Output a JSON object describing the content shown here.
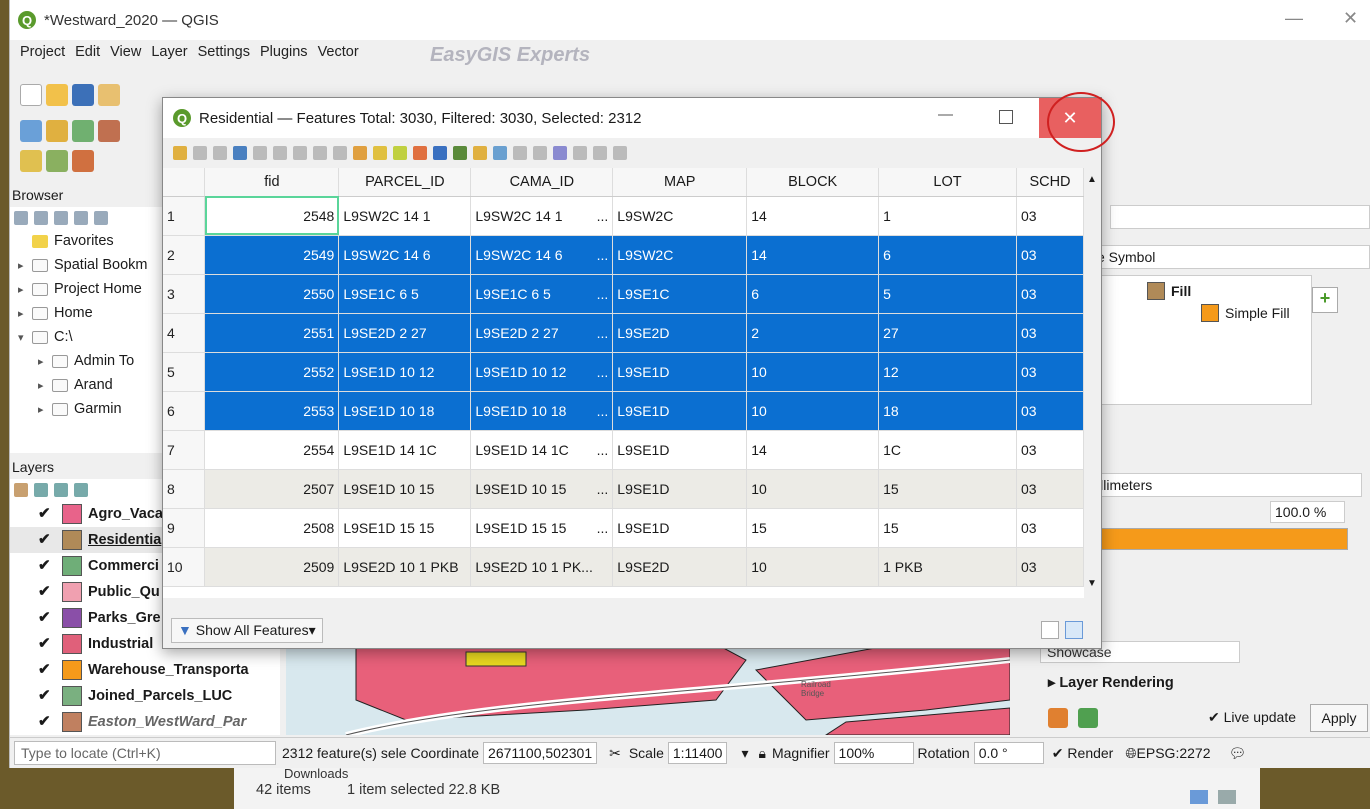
{
  "window": {
    "title": "*Westward_2020 — QGIS",
    "min": "—",
    "max": "☐",
    "close": "✕"
  },
  "menu": [
    "Project",
    "Edit",
    "View",
    "Layer",
    "Settings",
    "Plugins",
    "Vector"
  ],
  "watermark": "EasyGIS Experts",
  "browser": {
    "title": "Browser",
    "items": [
      {
        "label": "Favorites",
        "indent": 0
      },
      {
        "label": "Spatial Bookm",
        "indent": 0
      },
      {
        "label": "Project Home",
        "indent": 0
      },
      {
        "label": "Home",
        "indent": 0
      },
      {
        "label": "C:\\",
        "indent": 0
      },
      {
        "label": "Admin To",
        "indent": 1
      },
      {
        "label": "Arand",
        "indent": 1
      },
      {
        "label": "Garmin",
        "indent": 1
      }
    ]
  },
  "layers": {
    "title": "Layers",
    "items": [
      {
        "label": "Agro_Vaca",
        "color": "#e8638a"
      },
      {
        "label": "Residentia",
        "color": "#b08a58"
      },
      {
        "label": "Commerci",
        "color": "#6fae78"
      },
      {
        "label": "Public_Qu",
        "color": "#f0a0b0"
      },
      {
        "label": "Parks_Gre",
        "color": "#8a4fa8"
      },
      {
        "label": "Industrial",
        "color": "#e0607a"
      },
      {
        "label": "Warehouse_Transporta",
        "color": "#f59a1a"
      },
      {
        "label": "Joined_Parcels_LUC",
        "color": "#7ab080"
      },
      {
        "label": "Easton_WestWard_Par",
        "color": "#c08060"
      }
    ]
  },
  "attr": {
    "title": "Residential — Features Total: 3030, Filtered: 3030, Selected: 2312",
    "min": "—",
    "max": "☐",
    "close": "✕",
    "columns": [
      "fid",
      "PARCEL_ID",
      "CAMA_ID",
      "MAP",
      "BLOCK",
      "LOT",
      "SCHD"
    ],
    "rows": [
      {
        "n": "1",
        "fid": "2548",
        "parcel": "L9SW2C 14 1",
        "cama": "L9SW2C 14 1",
        "dots": "...",
        "map": "L9SW2C",
        "block": "14",
        "lot": "1",
        "schd": "03",
        "state": "focus"
      },
      {
        "n": "2",
        "fid": "2549",
        "parcel": "L9SW2C 14 6",
        "cama": "L9SW2C 14 6",
        "dots": "...",
        "map": "L9SW2C",
        "block": "14",
        "lot": "6",
        "schd": "03",
        "state": "sel"
      },
      {
        "n": "3",
        "fid": "2550",
        "parcel": "L9SE1C 6  5",
        "cama": "L9SE1C 6  5",
        "dots": "...",
        "map": "L9SE1C",
        "block": "6",
        "lot": "5",
        "schd": "03",
        "state": "sel"
      },
      {
        "n": "4",
        "fid": "2551",
        "parcel": "L9SE2D 2  27",
        "cama": "L9SE2D 2  27",
        "dots": "...",
        "map": "L9SE2D",
        "block": "2",
        "lot": "27",
        "schd": "03",
        "state": "sel"
      },
      {
        "n": "5",
        "fid": "2552",
        "parcel": "L9SE1D 10 12",
        "cama": "L9SE1D 10 12",
        "dots": "...",
        "map": "L9SE1D",
        "block": "10",
        "lot": "12",
        "schd": "03",
        "state": "sel"
      },
      {
        "n": "6",
        "fid": "2553",
        "parcel": "L9SE1D 10 18",
        "cama": "L9SE1D 10 18",
        "dots": "...",
        "map": "L9SE1D",
        "block": "10",
        "lot": "18",
        "schd": "03",
        "state": "sel"
      },
      {
        "n": "7",
        "fid": "2554",
        "parcel": "L9SE1D 14 1C",
        "cama": "L9SE1D 14 1C",
        "dots": "...",
        "map": "L9SE1D",
        "block": "14",
        "lot": "1C",
        "schd": "03",
        "state": ""
      },
      {
        "n": "8",
        "fid": "2507",
        "parcel": "L9SE1D 10 15",
        "cama": "L9SE1D 10 15",
        "dots": "...",
        "map": "L9SE1D",
        "block": "10",
        "lot": "15",
        "schd": "03",
        "state": "alt"
      },
      {
        "n": "9",
        "fid": "2508",
        "parcel": "L9SE1D 15 15",
        "cama": "L9SE1D 15 15",
        "dots": "...",
        "map": "L9SE1D",
        "block": "15",
        "lot": "15",
        "schd": "03",
        "state": ""
      },
      {
        "n": "10",
        "fid": "2509",
        "parcel": "L9SE2D 10 1 PKB",
        "cama": "L9SE2D 10 1 PK...",
        "dots": "",
        "map": "L9SE2D",
        "block": "10",
        "lot": "1 PKB",
        "schd": "03",
        "state": "alt"
      }
    ],
    "show_all": "Show All Features"
  },
  "style": {
    "symbol": "e Symbol",
    "fill": "Fill",
    "simple_fill": "Simple Fill",
    "unit": "illimeters",
    "opacity": "100.0 %",
    "preset": "Showcase",
    "layer_rendering": "Layer Rendering",
    "live_update": "Live update",
    "apply": "Apply",
    "fill_color": "#f59a1a"
  },
  "map": {
    "railroad": "Railroad\nBridge"
  },
  "status": {
    "locate": "Type to locate (Ctrl+K)",
    "selected": "2312 feature(s) sele",
    "coord_label": "Coordinate",
    "coord": "2671100,502301",
    "scale_label": "Scale",
    "scale": "1:11400",
    "magnifier_label": "Magnifier",
    "magnifier": "100%",
    "rotation_label": "Rotation",
    "rotation": "0.0 °",
    "render": "Render",
    "crs": "EPSG:2272"
  },
  "explorer": {
    "downloads": "Downloads",
    "items": "42 items",
    "selected": "1 item selected  22.8 KB"
  }
}
